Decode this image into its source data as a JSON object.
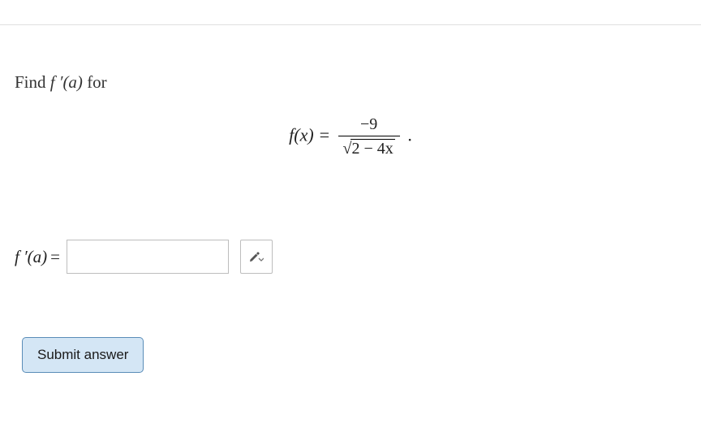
{
  "problem": {
    "prompt_prefix": "Find ",
    "prompt_math": "f ′(a)",
    "prompt_suffix": " for"
  },
  "equation": {
    "lhs": "f(x) = ",
    "numerator": "−9",
    "denominator_radicand": "2 − 4x",
    "trailing": "."
  },
  "answer": {
    "label_math": "f ′(a)",
    "label_eq": "=",
    "value": ""
  },
  "buttons": {
    "submit": "Submit answer"
  },
  "icons": {
    "equation_editor": "pencil-dropdown-icon"
  }
}
